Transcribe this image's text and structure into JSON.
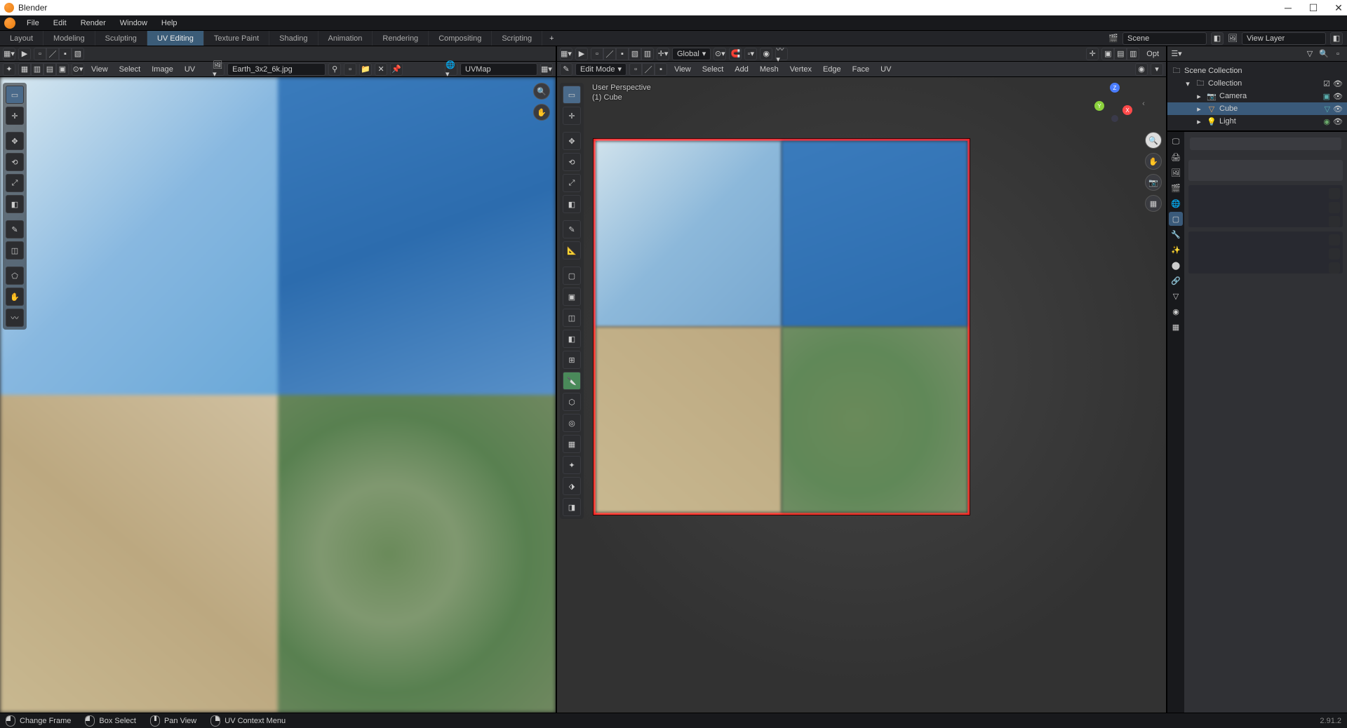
{
  "app": {
    "title": "Blender",
    "version": "2.91.2"
  },
  "menubar": [
    "File",
    "Edit",
    "Render",
    "Window",
    "Help"
  ],
  "workspaces": {
    "tabs": [
      "Layout",
      "Modeling",
      "Sculpting",
      "UV Editing",
      "Texture Paint",
      "Shading",
      "Animation",
      "Rendering",
      "Compositing",
      "Scripting"
    ],
    "active": "UV Editing"
  },
  "scene": {
    "name": "Scene",
    "view_layer": "View Layer"
  },
  "uv_editor": {
    "menus": [
      "View",
      "Select",
      "Image",
      "UV"
    ],
    "image_name": "Earth_3x2_6k.jpg",
    "uvmap": "UVMap"
  },
  "viewport": {
    "mode": "Edit Mode",
    "menus": [
      "View",
      "Select",
      "Add",
      "Mesh",
      "Vertex",
      "Edge",
      "Face",
      "UV"
    ],
    "orientation": "Global",
    "info_line1": "User Perspective",
    "info_line2": "(1) Cube",
    "options": "Opt"
  },
  "outliner": {
    "root": "Scene Collection",
    "collection": "Collection",
    "items": [
      {
        "name": "Camera",
        "icon": "📷"
      },
      {
        "name": "Cube",
        "icon": "▽",
        "selected": true
      },
      {
        "name": "Light",
        "icon": "💡"
      }
    ]
  },
  "statusbar": {
    "items": [
      "Change Frame",
      "Box Select",
      "Pan View",
      "UV Context Menu"
    ]
  }
}
